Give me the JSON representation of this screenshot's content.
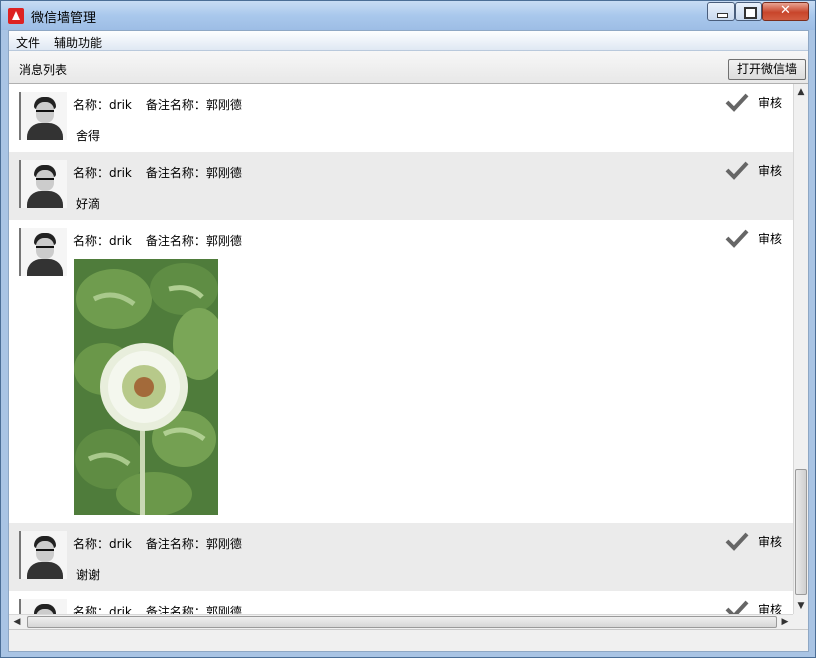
{
  "window": {
    "title": "微信墙管理",
    "icon": "app-logo-icon"
  },
  "menu": {
    "items": [
      "文件",
      "辅助功能"
    ]
  },
  "toolbar": {
    "list_title": "消息列表",
    "open_button_label": "打开微信墙"
  },
  "messages": [
    {
      "name_label": "名称：",
      "name": "drik",
      "remark_label": "备注名称：",
      "remark": "郭刚德",
      "text": "舍得",
      "audit_label": "审核"
    },
    {
      "name_label": "名称：",
      "name": "drik",
      "remark_label": "备注名称：",
      "remark": "郭刚德",
      "text": "好滴",
      "audit_label": "审核"
    },
    {
      "name_label": "名称：",
      "name": "drik",
      "remark_label": "备注名称：",
      "remark": "郭刚德",
      "text": "",
      "image": "clover-flower-photo",
      "audit_label": "审核"
    },
    {
      "name_label": "名称：",
      "name": "drik",
      "remark_label": "备注名称：",
      "remark": "郭刚德",
      "text": "谢谢",
      "audit_label": "审核"
    },
    {
      "name_label": "名称：",
      "name": "drik",
      "remark_label": "备注名称：",
      "remark": "郭刚德",
      "text": "",
      "audit_label": "审核"
    }
  ],
  "icons": {
    "check": "checkmark-icon",
    "scroll_up": "arrow-up-icon",
    "scroll_down": "arrow-down-icon",
    "scroll_left": "arrow-left-icon",
    "scroll_right": "arrow-right-icon"
  },
  "colors": {
    "title_bar": "#a9c8ec",
    "alt_row": "#ebebeb",
    "close_button": "#c8452b",
    "check": "#666666"
  }
}
